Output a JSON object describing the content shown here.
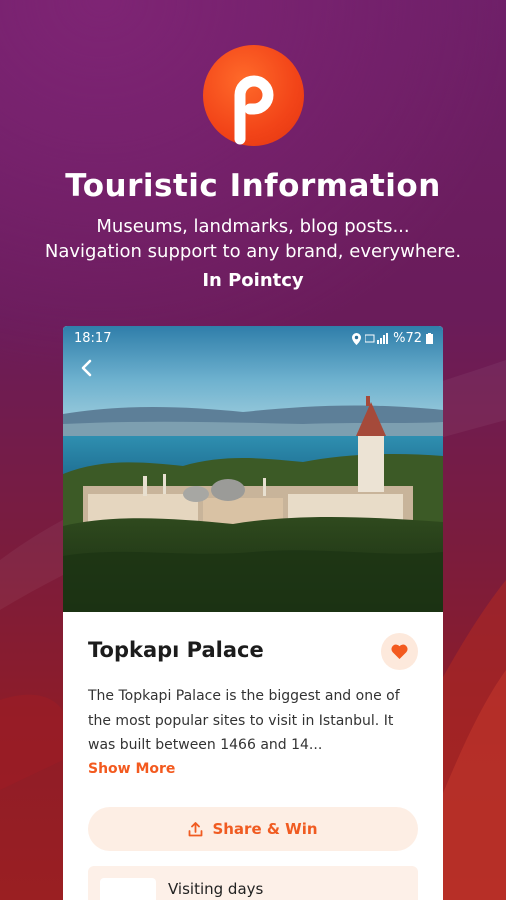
{
  "hero": {
    "title": "Touristic Information",
    "subtitle_line1": "Museums, landmarks, blog posts...",
    "subtitle_line2": "Navigation support to any brand, everywhere.",
    "tagline": "In Pointcy"
  },
  "colors": {
    "brand_orange": "#f24418",
    "accent": "#f35a1f",
    "background_top": "#6e1f68",
    "background_bottom": "#9a1f22"
  },
  "phone": {
    "status_bar": {
      "time": "18:17",
      "battery": "%72",
      "icons": [
        "location-icon",
        "signal-icon",
        "battery-icon"
      ]
    },
    "place": {
      "name": "Topkapı Palace",
      "description": "The Topkapi Palace is the biggest and one of the most popular sites to visit in Istanbul. It was built between 1466 and 14...",
      "show_more": "Show More",
      "share_label": "Share & Win",
      "visiting_days_label": "Visiting days"
    }
  }
}
